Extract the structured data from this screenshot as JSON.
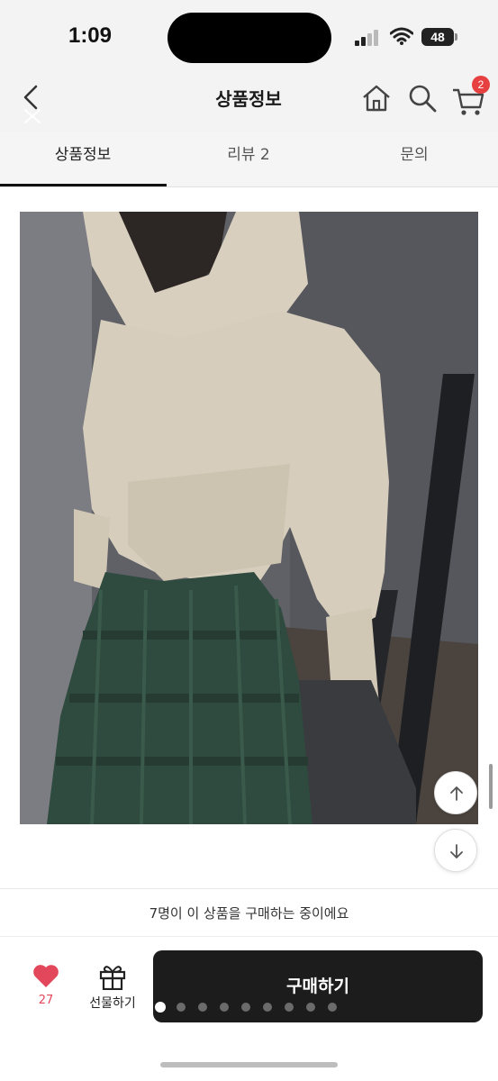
{
  "status_bar": {
    "time": "1:09",
    "battery_level": "48"
  },
  "header": {
    "title": "상품정보",
    "cart_count": "2",
    "icons": [
      "back-icon",
      "home-icon",
      "search-icon",
      "cart-icon"
    ]
  },
  "tabs": [
    {
      "label": "상품정보",
      "active": true
    },
    {
      "label": "리뷰 2",
      "active": false
    },
    {
      "label": "문의",
      "active": false
    }
  ],
  "bottom": {
    "buying_message": "7명이 이 상품을 구매하는 중이에요",
    "like_count": "27",
    "gift_label": "선물하기",
    "buy_label": "구매하기",
    "carousel": {
      "total_pages": 9,
      "current_page": 1
    }
  },
  "colors": {
    "accent_red": "#e64040",
    "heart_pink": "#e2475b",
    "buy_button": "#1c1c1c",
    "header_bg": "#f3f3f3"
  }
}
